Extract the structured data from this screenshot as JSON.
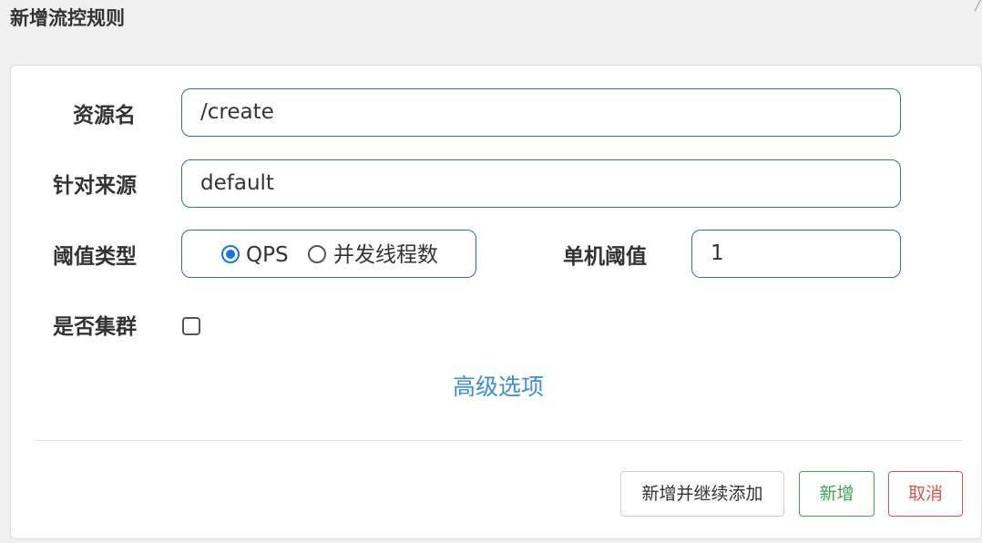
{
  "dialog": {
    "title": "新增流控规则"
  },
  "form": {
    "resource_label": "资源名",
    "resource_value": "/create",
    "source_label": "针对来源",
    "source_value": "default",
    "threshold_type_label": "阈值类型",
    "threshold_type_options": [
      {
        "label": "QPS",
        "checked": true
      },
      {
        "label": "并发线程数",
        "checked": false
      }
    ],
    "single_threshold_label": "单机阈值",
    "single_threshold_value": "1",
    "cluster_label": "是否集群",
    "cluster_checked": false,
    "advanced_label": "高级选项"
  },
  "footer": {
    "add_continue_label": "新增并继续添加",
    "add_label": "新增",
    "cancel_label": "取消"
  },
  "colors": {
    "input_border": "#2f6fa5",
    "link": "#3b8ed0",
    "success": "#3da552",
    "danger": "#d9534f",
    "radio_checked": "#1a73e8"
  }
}
